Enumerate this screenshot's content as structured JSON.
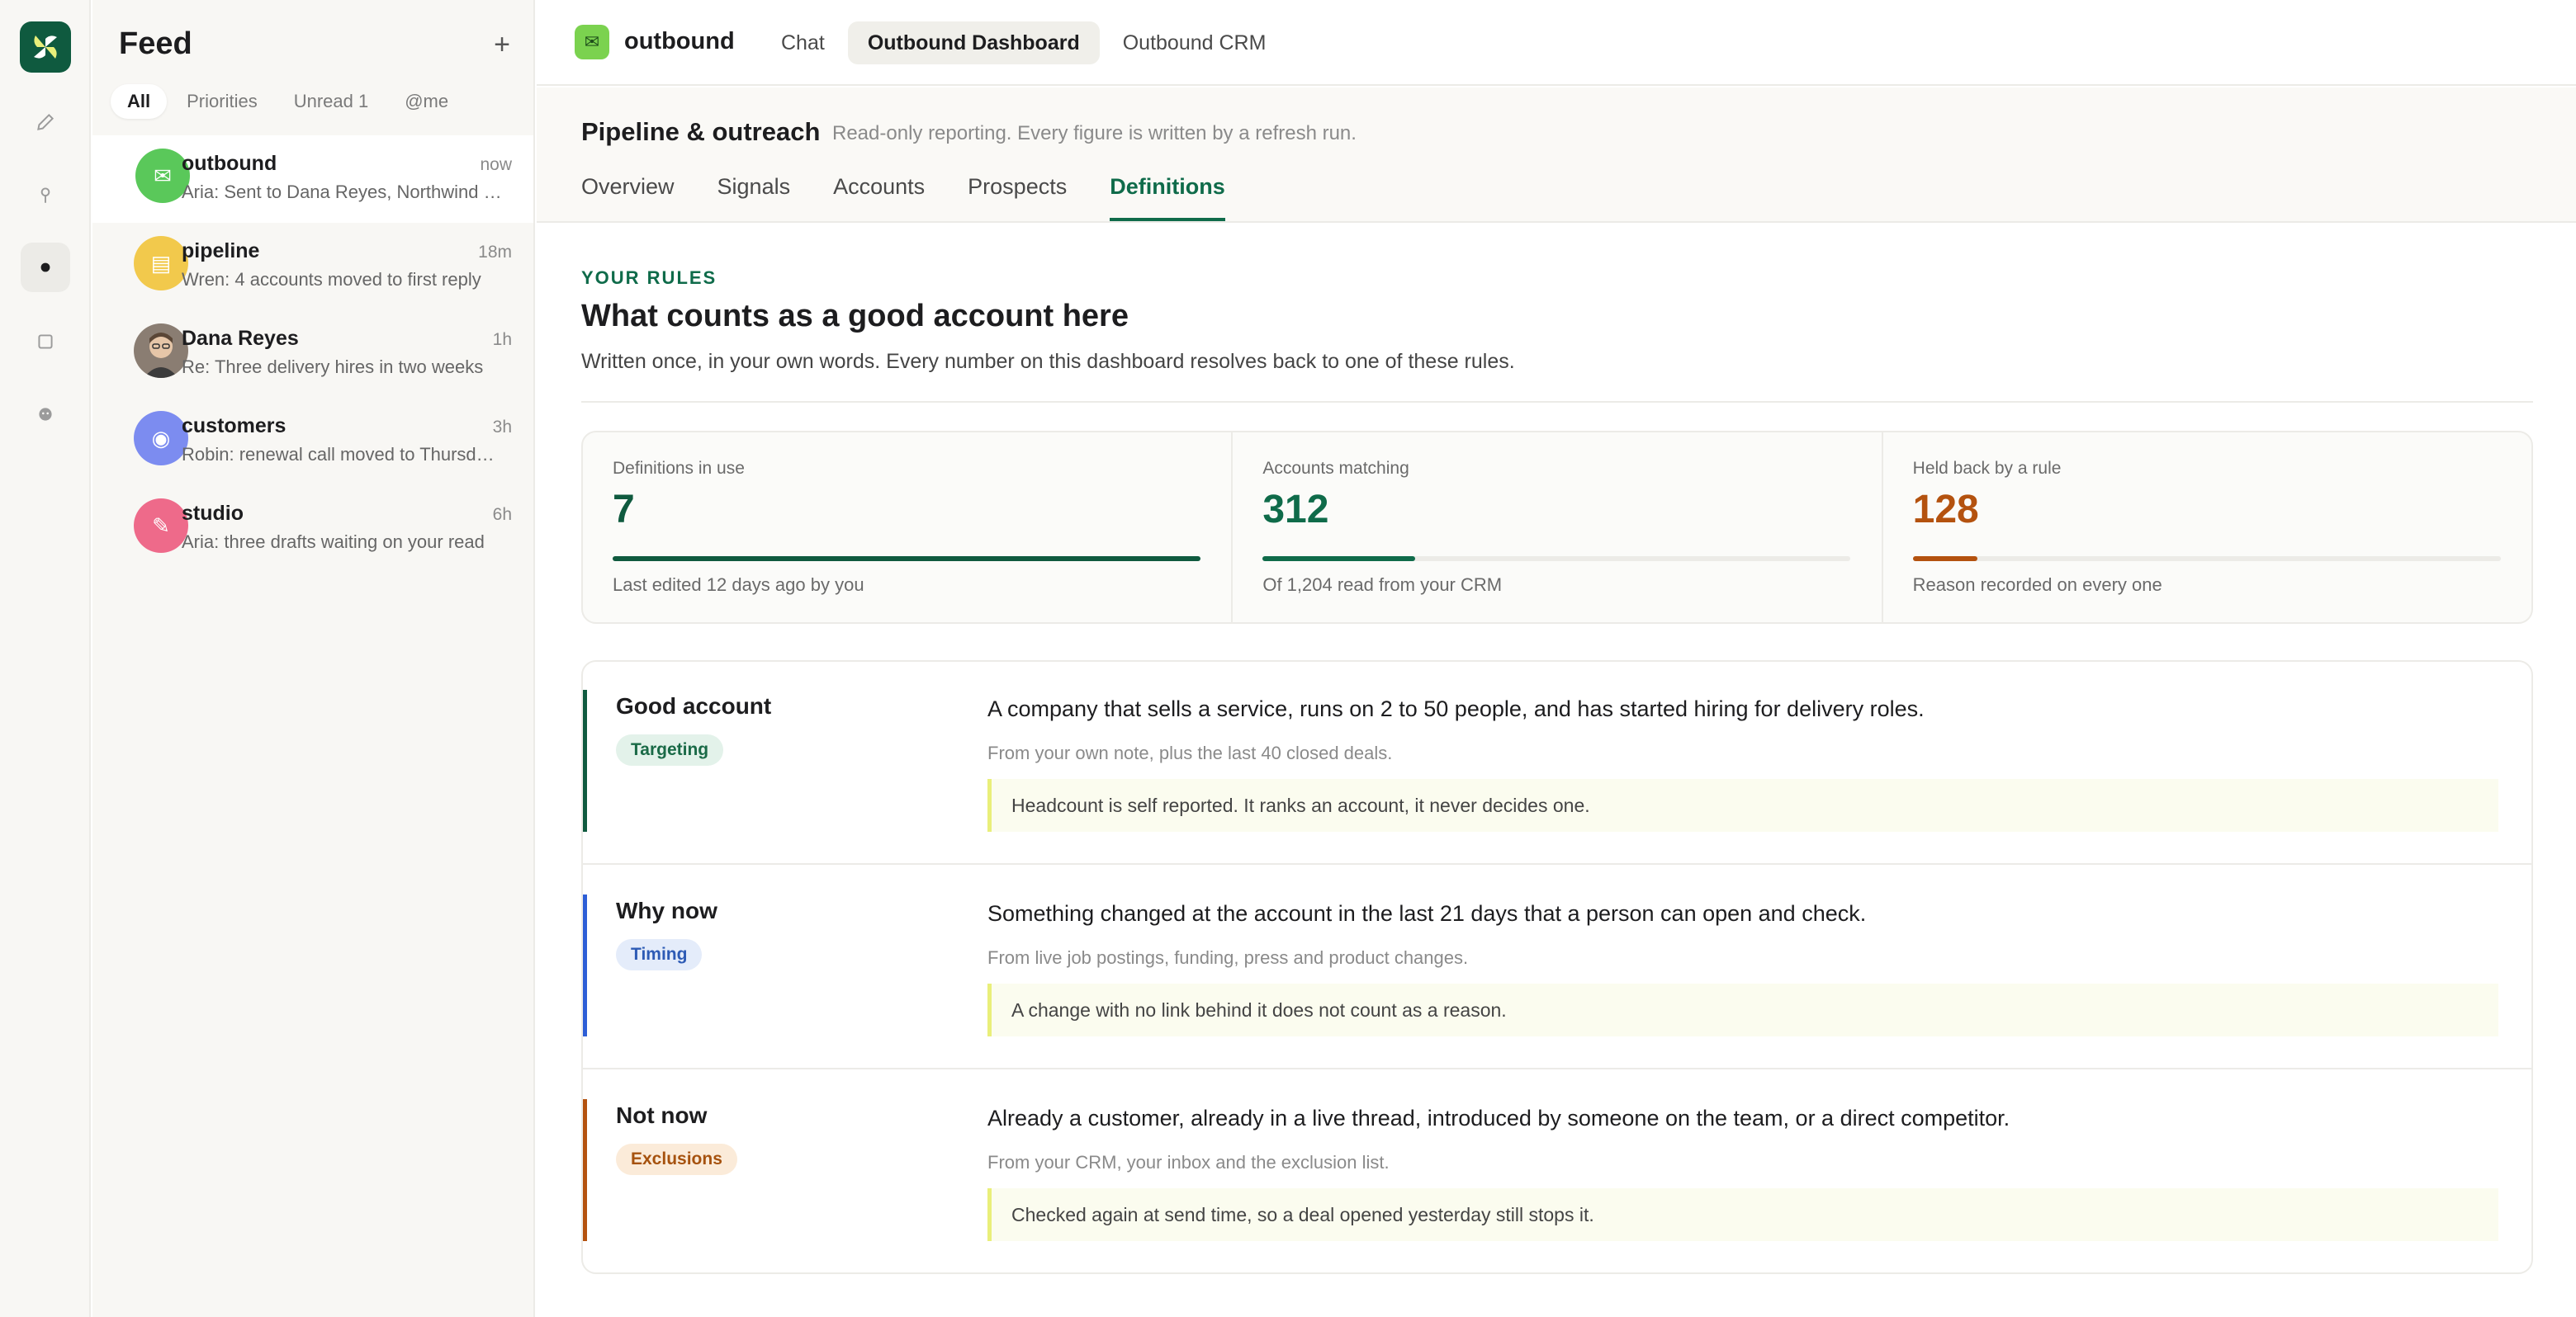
{
  "rail": {
    "icons": [
      "pencil-icon",
      "pin-icon",
      "dot-icon",
      "square-icon",
      "face-icon"
    ]
  },
  "feed": {
    "title": "Feed",
    "add_label": "+",
    "filters": [
      "All",
      "Priorities",
      "Unread 1",
      "@me"
    ],
    "items": [
      {
        "name": "outbound",
        "time": "now",
        "preview": "Aria: Sent to Dana Reyes, Northwind …",
        "color": "#5ac85a",
        "icon": "✉"
      },
      {
        "name": "pipeline",
        "time": "18m",
        "preview": "Wren: 4 accounts moved to first reply",
        "color": "#f2c94c",
        "icon": "▤"
      },
      {
        "name": "Dana Reyes",
        "time": "1h",
        "preview": "Re: Three delivery hires in two weeks",
        "color": "#6b5a4e",
        "icon": ""
      },
      {
        "name": "customers",
        "time": "3h",
        "preview": "Robin: renewal call moved to Thursd…",
        "color": "#7c8cf0",
        "icon": "◉"
      },
      {
        "name": "studio",
        "time": "6h",
        "preview": "Aria: three drafts waiting on your read",
        "color": "#ee6a8a",
        "icon": "✎"
      }
    ]
  },
  "topbar": {
    "app_name": "outbound",
    "app_icon": "✉",
    "tabs": [
      "Chat",
      "Outbound Dashboard",
      "Outbound CRM"
    ]
  },
  "subheader": {
    "title": "Pipeline & outreach",
    "note": "Read-only reporting. Every figure is written by a refresh run.",
    "tabs": [
      "Overview",
      "Signals",
      "Accounts",
      "Prospects",
      "Definitions"
    ]
  },
  "section": {
    "eyebrow": "YOUR RULES",
    "heading": "What counts as a good account here",
    "lede": "Written once, in your own words. Every number on this dashboard resolves back to one of these rules."
  },
  "stats": [
    {
      "label": "Definitions in use",
      "value": "7",
      "fill": 1.0,
      "color": "#0f5a3f",
      "foot": "Last edited 12 days ago by you"
    },
    {
      "label": "Accounts matching",
      "value": "312",
      "fill": 0.26,
      "color": "#0f6b4a",
      "foot": "Of 1,204 read from your CRM"
    },
    {
      "label": "Held back by a rule",
      "value": "128",
      "fill": 0.11,
      "color": "#b4520f",
      "foot": "Reason recorded on every one"
    }
  ],
  "rules": [
    {
      "name": "Good account",
      "tag": "Targeting",
      "tag_bg": "#e3f2ea",
      "tag_color": "#1a6a47",
      "bar_color": "#0f5a3f",
      "desc": "A company that sells a service, runs on 2 to 50 people, and has started hiring for delivery roles.",
      "source": "From your own note, plus the last 40 closed deals.",
      "note": "Headcount is self reported. It ranks an account, it never decides one."
    },
    {
      "name": "Why now",
      "tag": "Timing",
      "tag_bg": "#e4ecfa",
      "tag_color": "#2d5bb5",
      "bar_color": "#2d5ed6",
      "desc": "Something changed at the account in the last 21 days that a person can open and check.",
      "source": "From live job postings, funding, press and product changes.",
      "note": "A change with no link behind it does not count as a reason."
    },
    {
      "name": "Not now",
      "tag": "Exclusions",
      "tag_bg": "#fbebd9",
      "tag_color": "#a6520e",
      "bar_color": "#b4520f",
      "desc": "Already a customer, already in a live thread, introduced by someone on the team, or a direct competitor.",
      "source": "From your CRM, your inbox and the exclusion list.",
      "note": "Checked again at send time, so a deal opened yesterday still stops it."
    }
  ]
}
